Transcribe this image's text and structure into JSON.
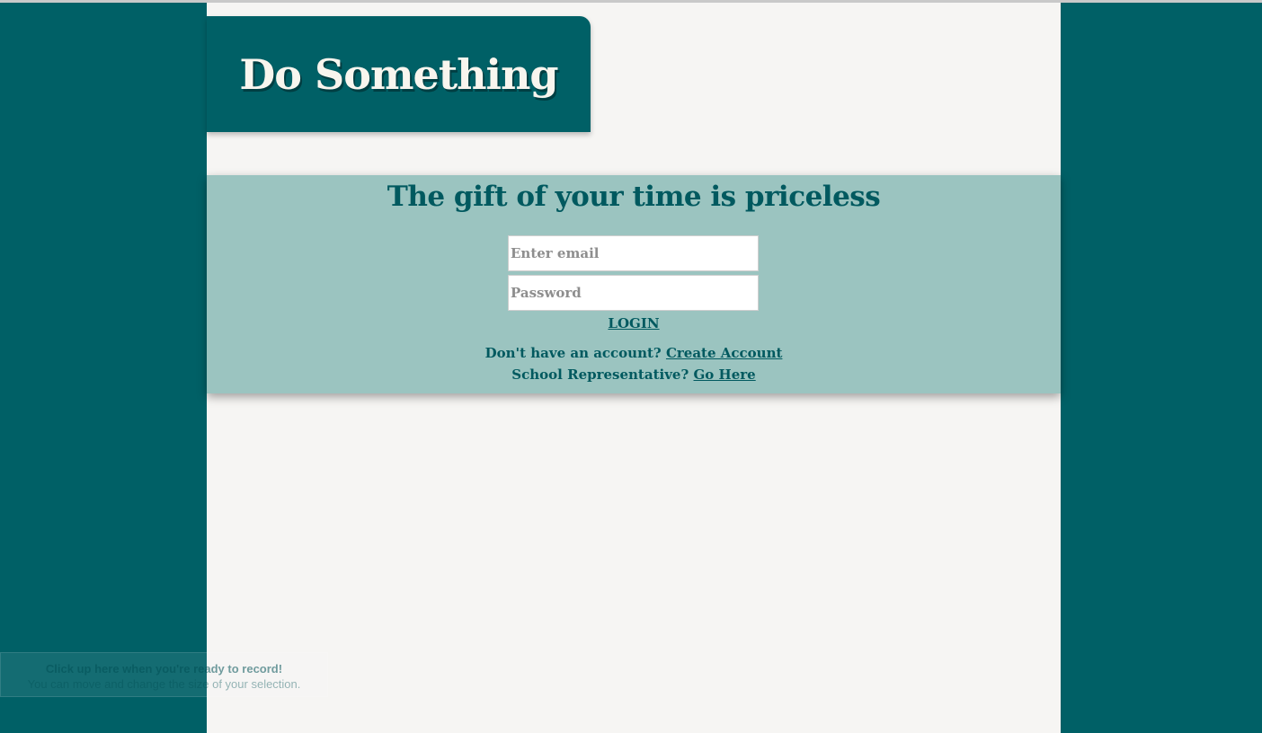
{
  "brand": {
    "title": "Do Something"
  },
  "login": {
    "tagline": "The gift of your time is priceless",
    "email_placeholder": "Enter email",
    "password_placeholder": "Password",
    "login_label": "LOGIN",
    "account_prompt": "Don't have an account?",
    "account_link": "Create Account",
    "school_prompt": "School Representative?",
    "school_link": "Go Here"
  },
  "recorder_overlay": {
    "title": "Click up here when you're ready to record!",
    "subtitle": "You can move and change the size of your selection."
  },
  "colors": {
    "background": "#006066",
    "panel": "#9bc4c0",
    "accent_text": "#00595f",
    "page": "#f6f5f3"
  }
}
